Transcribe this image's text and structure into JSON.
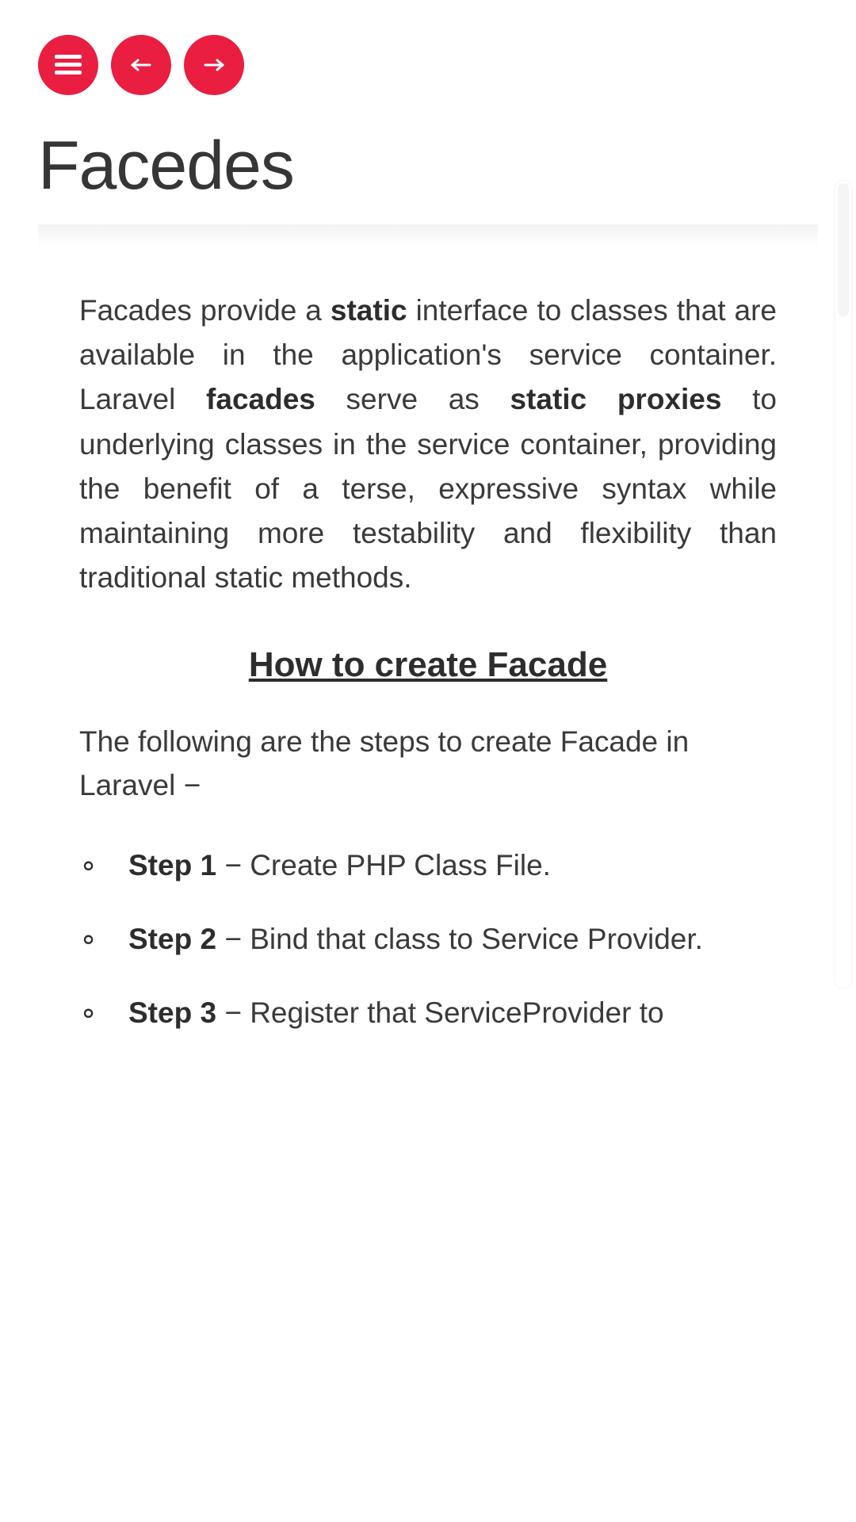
{
  "toolbar": {
    "menu_icon": "hamburger",
    "prev_icon": "arrow-left",
    "next_icon": "arrow-right"
  },
  "page": {
    "title": "Facedes"
  },
  "intro": {
    "p1a": "Facades provide a ",
    "p1b_bold": "static",
    "p1c": " interface to classes that are available in the application's service container. Laravel ",
    "p1d_bold": "facades",
    "p1e": " serve as ",
    "p1f_bold": "static proxies",
    "p1g": " to underlying classes in the service container, providing the benefit of a terse, expressive syntax while maintaining more testability and flexibility than traditional static methods."
  },
  "section": {
    "heading": "How to create Facade",
    "lead": "The following are the steps to create Facade in Laravel −"
  },
  "steps": [
    {
      "label": "Step 1",
      "text": " − Create PHP Class File."
    },
    {
      "label": "Step 2",
      "text": " − Bind that class to Service Provider."
    },
    {
      "label": "Step 3",
      "text": " − Register that ServiceProvider to"
    }
  ]
}
